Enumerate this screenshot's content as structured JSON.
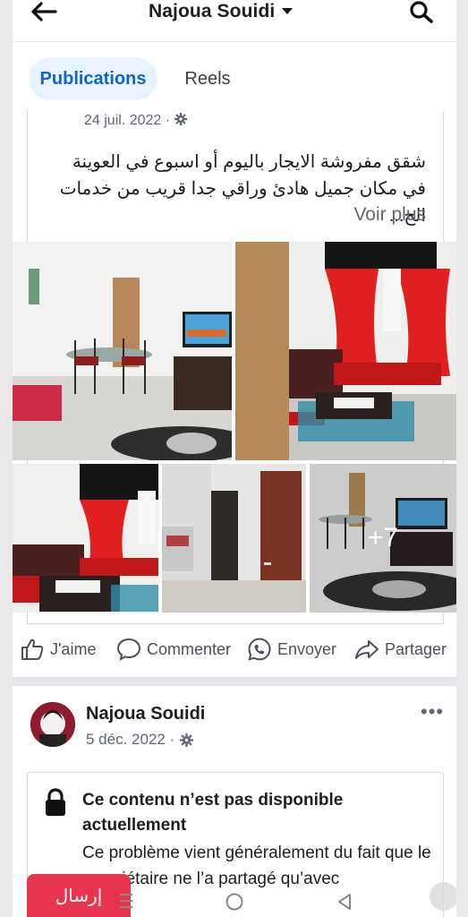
{
  "header": {
    "title": "Najoua Souidi",
    "back_icon": "arrow-left-icon",
    "caret_icon": "caret-down-icon",
    "search_icon": "search-icon"
  },
  "tabs": [
    {
      "label": "Publications",
      "active": true
    },
    {
      "label": "Reels",
      "active": false
    }
  ],
  "post1": {
    "date": "24 juil. 2022 ·",
    "text": "شقق مفروشة الايجار باليوم أو اسبوع في العوينة في مكان جميل هادئ وراقي جدا قريب من خدمات الح...",
    "see_more": "Voir plus",
    "more_photos": "+7"
  },
  "actions": {
    "like": "J'aime",
    "comment": "Commenter",
    "send": "Envoyer",
    "share": "Partager"
  },
  "post2": {
    "author": "Najoua Souidi",
    "date": "5 déc. 2022 ·",
    "menu": "•••",
    "unavailable_title": "Ce contenu n’est pas disponible actuellement",
    "unavailable_body": "Ce problème vient généralement du fait que le propriétaire ne l’a partagé qu’avec"
  },
  "overlay": {
    "send_button": "إرسال"
  },
  "colors": {
    "accent": "#1565c0",
    "tab_bg": "#e7f3ff",
    "send_button": "#e8354f"
  }
}
